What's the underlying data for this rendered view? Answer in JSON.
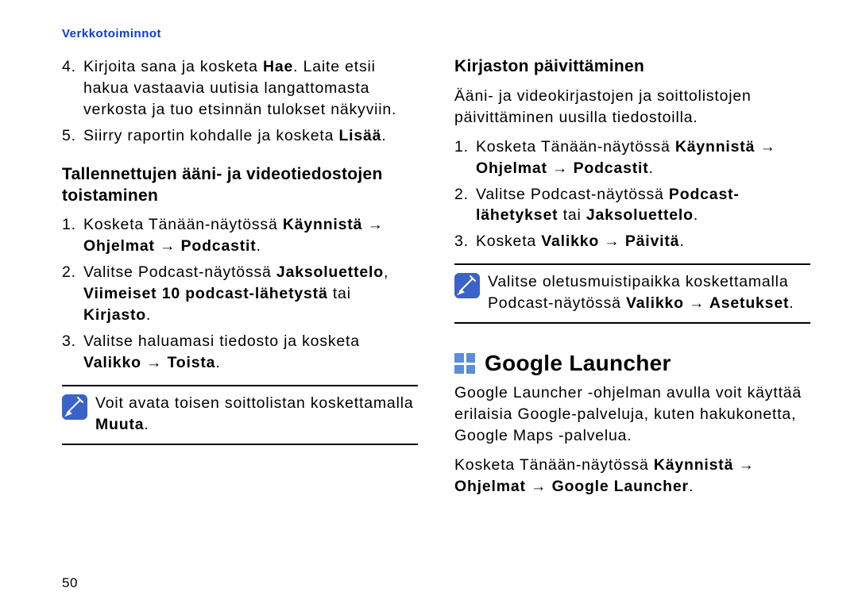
{
  "header": "Verkkotoiminnot",
  "page_number": "50",
  "left": {
    "cont_list": [
      {
        "num": "4.",
        "pre": "Kirjoita sana ja kosketa ",
        "bold": "Hae",
        "post": ". Laite etsii hakua vastaavia uutisia langattomasta verkosta ja tuo etsinnän tulokset näkyviin."
      },
      {
        "num": "5.",
        "pre": "Siirry raportin kohdalle ja kosketa ",
        "bold": "Lisää",
        "post": "."
      }
    ],
    "h2": "Tallennettujen ääni- ja videotiedostojen toistaminen",
    "list": [
      {
        "num": "1.",
        "pre": "Kosketa Tänään-näytössä ",
        "bold": "Käynnistä → Ohjelmat → Podcastit",
        "post": "."
      },
      {
        "num": "2.",
        "pre": "Valitse Podcast-näytössä ",
        "bold": "Jaksoluettelo",
        "mid1": ", ",
        "bold2": "Viimeiset 10 podcast-lähetystä",
        "mid2": " tai ",
        "bold3": "Kirjasto",
        "post": "."
      },
      {
        "num": "3.",
        "pre": "Valitse haluamasi tiedosto ja kosketa ",
        "bold": "Valikko → Toista",
        "post": "."
      }
    ],
    "note": {
      "pre": "Voit avata toisen soittolistan koskettamalla ",
      "bold": "Muuta",
      "post": "."
    }
  },
  "right": {
    "h2": "Kirjaston päivittäminen",
    "intro": "Ääni- ja videokirjastojen ja soittolistojen päivittäminen uusilla tiedostoilla.",
    "list": [
      {
        "num": "1.",
        "pre": "Kosketa Tänään-näytössä ",
        "bold": "Käynnistä → Ohjelmat → Podcastit",
        "post": "."
      },
      {
        "num": "2.",
        "pre": "Valitse Podcast-näytössä ",
        "bold": "Podcast-lähetykset",
        "mid": " tai ",
        "bold2": "Jaksoluettelo",
        "post": "."
      },
      {
        "num": "3.",
        "pre": "Kosketa ",
        "bold": "Valikko → Päivitä",
        "post": "."
      }
    ],
    "note": {
      "pre": "Valitse oletusmuistipaikka koskettamalla Podcast-näytössä ",
      "bold": "Valikko → Asetukset",
      "post": "."
    },
    "h1": "Google Launcher",
    "h1_para": "Google Launcher -ohjelman avulla voit käyttää erilaisia Google-palveluja, kuten hakukonetta,  Google Maps -palvelua.",
    "h1_line2_pre": "Kosketa Tänään-näytössä ",
    "h1_line2_bold": "Käynnistä → Ohjelmat → Google Launcher",
    "h1_line2_post": "."
  }
}
